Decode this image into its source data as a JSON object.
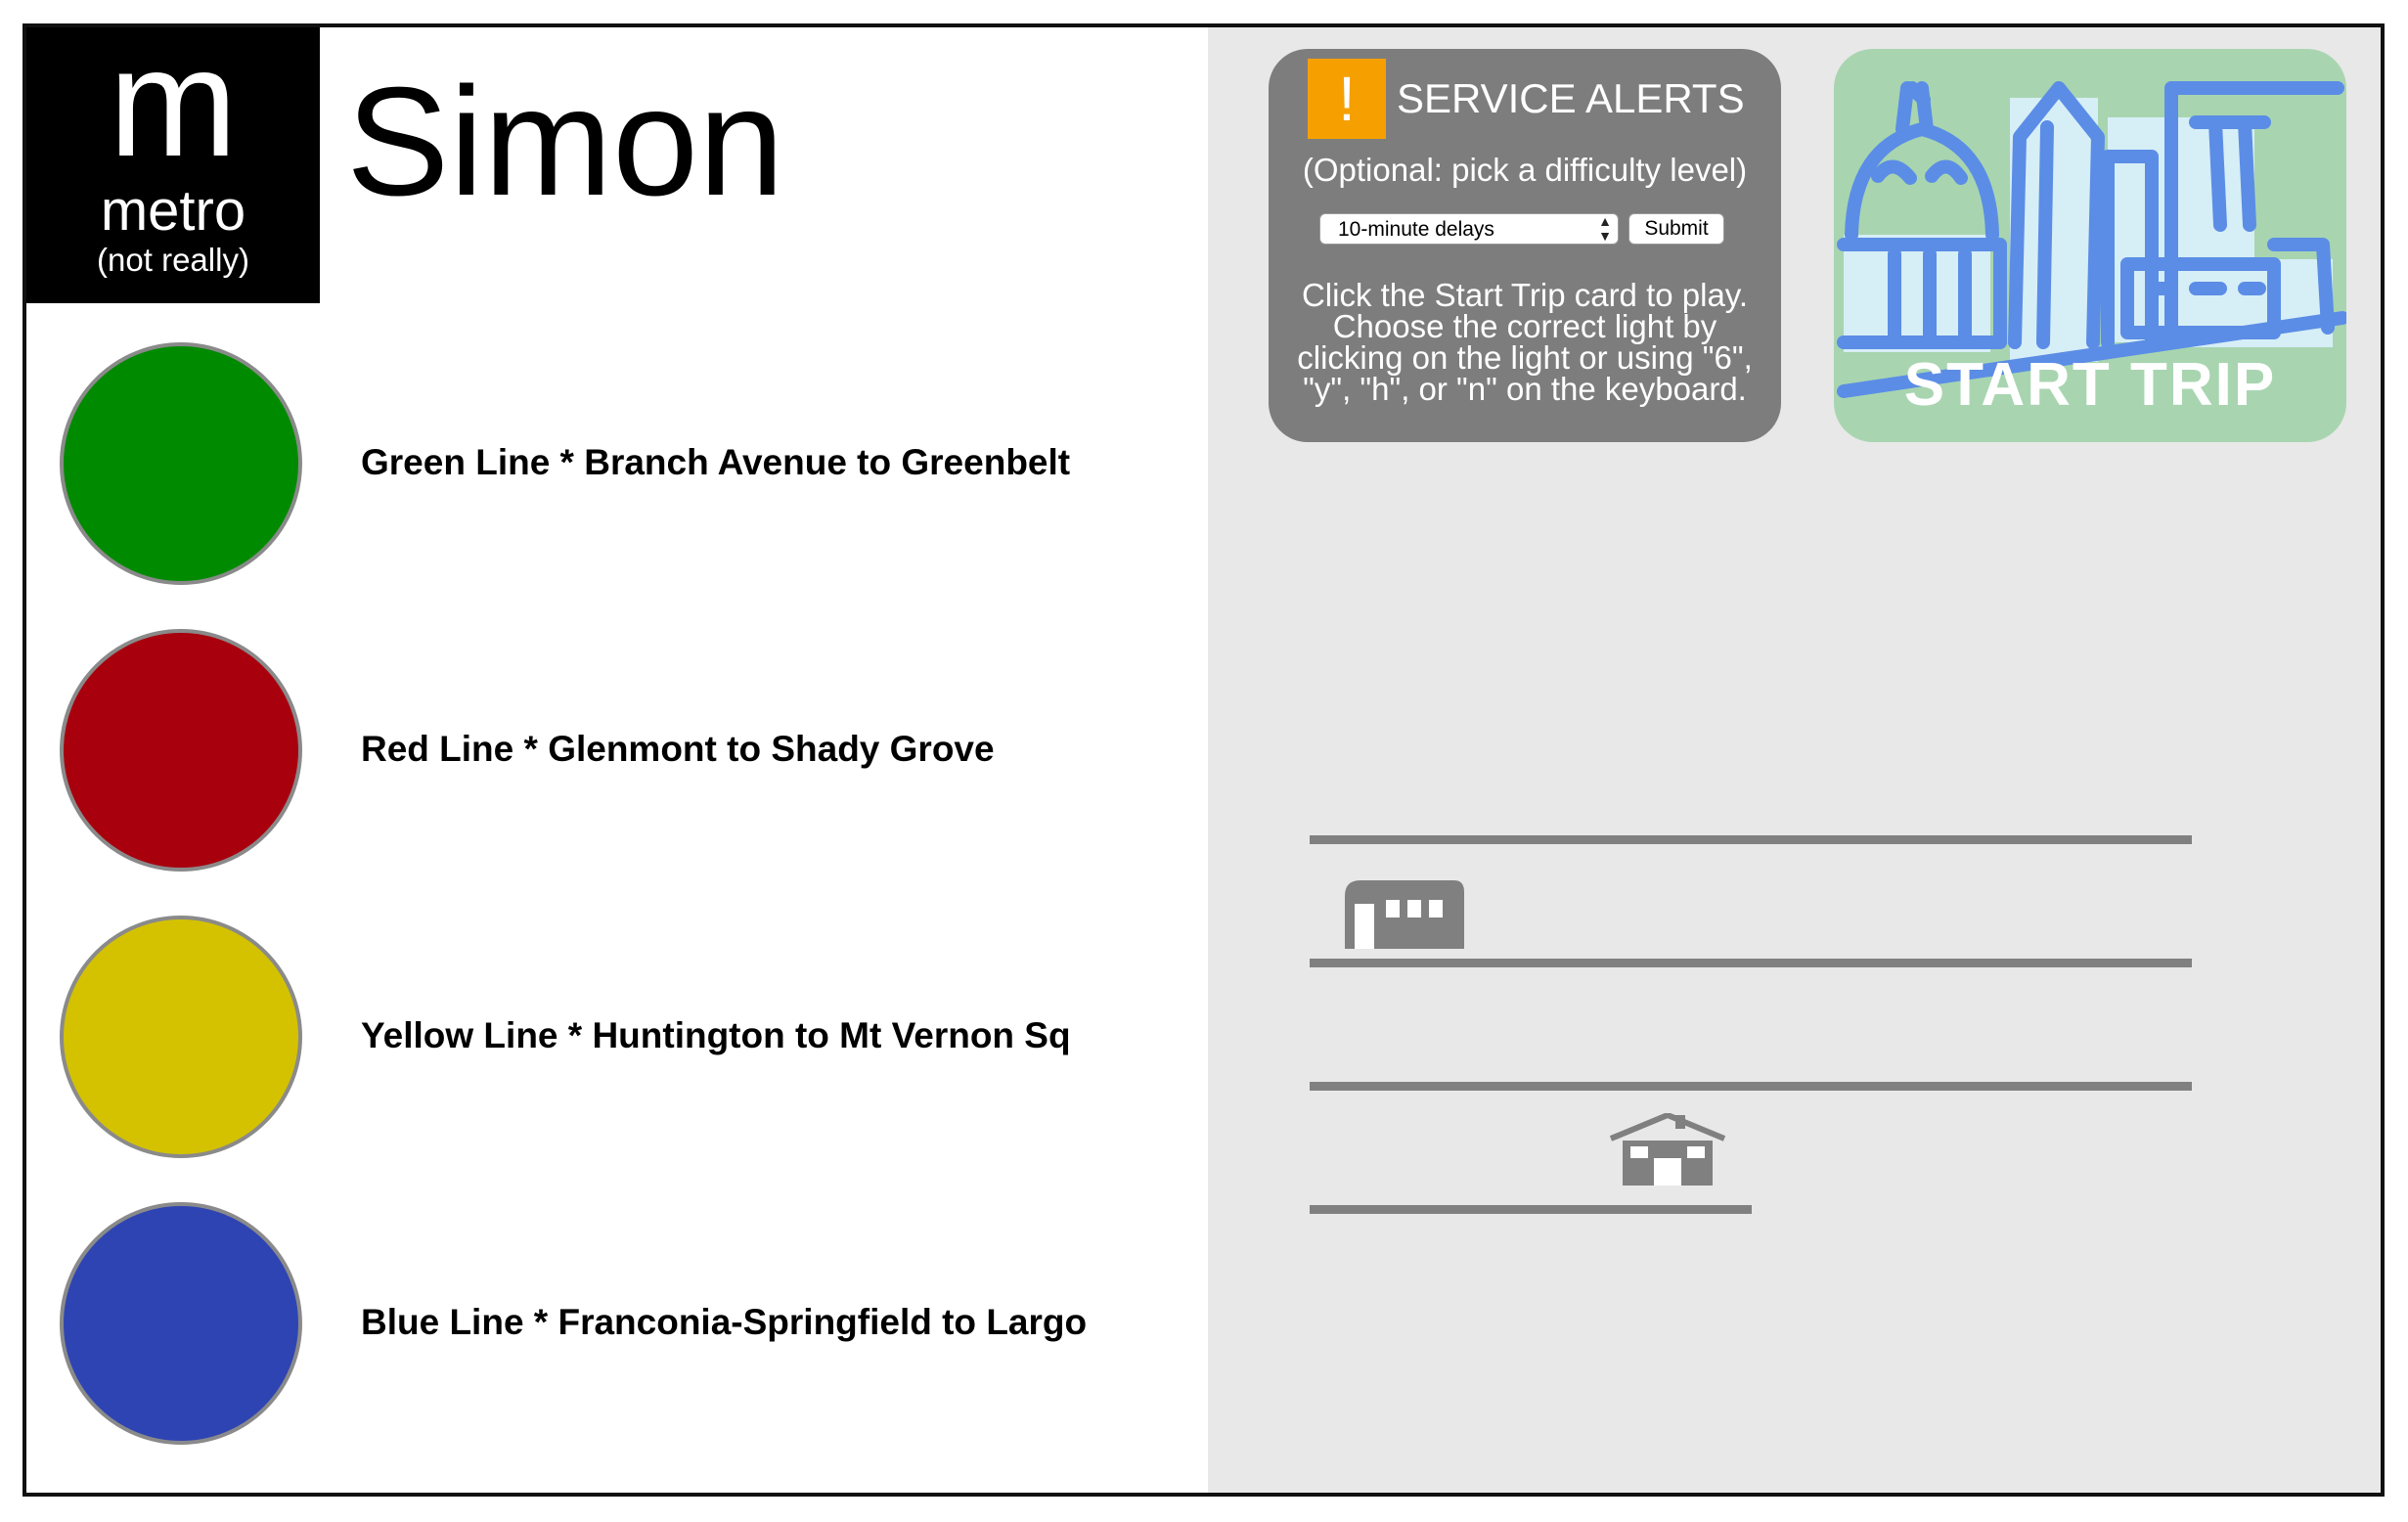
{
  "logo": {
    "letter": "m",
    "word": "metro",
    "sub": "(not really)"
  },
  "player": {
    "name": "Simon"
  },
  "lights": [
    {
      "label": "Green Line * Branch Avenue to Greenbelt",
      "color": "#008a00",
      "key": "g"
    },
    {
      "label": "Red Line * Glenmont to Shady Grove",
      "color": "#a8000d",
      "key": "r"
    },
    {
      "label": "Yellow Line * Huntington to Mt Vernon Sq",
      "color": "#d4c200",
      "key": "y"
    },
    {
      "label": "Blue Line * Franconia-Springfield to Largo",
      "color": "#2e44b3",
      "key": "b"
    }
  ],
  "alerts": {
    "badge": "!",
    "title": "SERVICE ALERTS",
    "optional_text": "(Optional: pick a difficulty level)",
    "difficulty_selected": "10-minute delays",
    "submit_label": "Submit",
    "instructions": "Click the Start Trip card to play. Choose the correct light by clicking on the light or using \"6\", \"y\", \"h\", or \"n\" on the keyboard.",
    "badge_color": "#f5a000",
    "panel_color": "#7d7d7d"
  },
  "start_card": {
    "label": "START TRIP",
    "background_color": "#a8d5b0",
    "line_color": "#5b8de6"
  },
  "icons": {
    "train": "train-icon",
    "station": "station-house-icon"
  }
}
